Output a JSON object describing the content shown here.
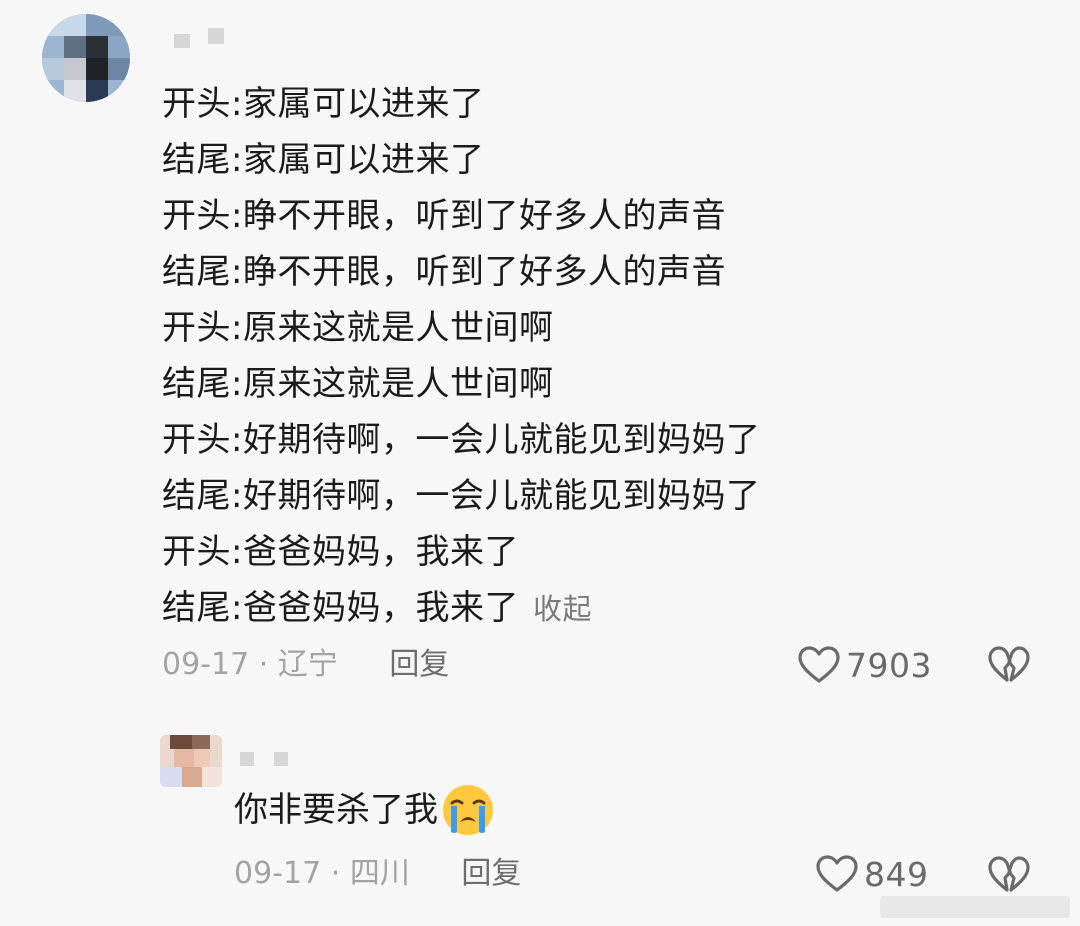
{
  "main_comment": {
    "lines": [
      "开头:家属可以进来了",
      "结尾:家属可以进来了",
      "开头:睁不开眼，听到了好多人的声音",
      "结尾:睁不开眼，听到了好多人的声音",
      "开头:原来这就是人世间啊",
      "结尾:原来这就是人世间啊",
      "开头:好期待啊，一会儿就能见到妈妈了",
      "结尾:好期待啊，一会儿就能见到妈妈了",
      "开头:爸爸妈妈，我来了",
      "结尾:爸爸妈妈，我来了"
    ],
    "collapse_label": "收起",
    "date": "09-17",
    "separator": "·",
    "location": "辽宁",
    "reply_label": "回复",
    "like_count": "7903"
  },
  "reply_comment": {
    "text": "你非要杀了我",
    "emoji": "loudly-crying-face",
    "date": "09-17",
    "separator": "·",
    "location": "四川",
    "reply_label": "回复",
    "like_count": "849"
  },
  "colors": {
    "background": "#f7f7f7",
    "text": "#1b1b1b",
    "meta": "#a3a3a3",
    "icon": "#6a6a6a",
    "emoji_face": "#ffc83d",
    "emoji_tear": "#3b9cf5"
  }
}
